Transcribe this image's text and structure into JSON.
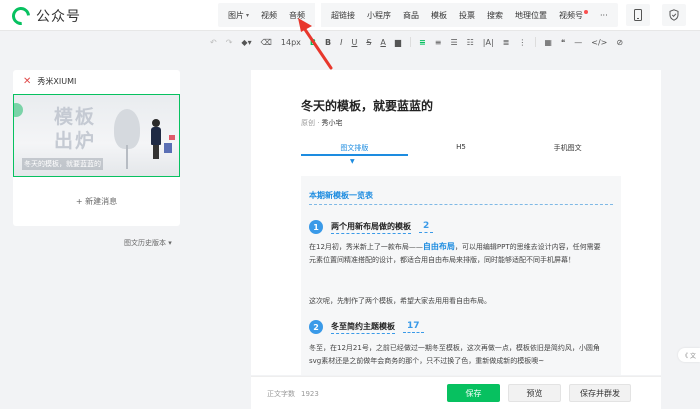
{
  "header": {
    "logo_text": "公众号",
    "insert_items": [
      {
        "label": "图片",
        "caret": "▾"
      },
      {
        "label": "视频"
      },
      {
        "label": "音频"
      }
    ],
    "insert_items_2": [
      {
        "label": "超链接"
      },
      {
        "label": "小程序"
      },
      {
        "label": "商品"
      },
      {
        "label": "模板"
      },
      {
        "label": "投票"
      },
      {
        "label": "搜索"
      },
      {
        "label": "地理位置"
      },
      {
        "label": "视频号"
      }
    ],
    "more_label": "···",
    "icons": [
      "mobile-icon",
      "shield-icon"
    ]
  },
  "format_toolbar": {
    "undo": "↶",
    "redo": "↷",
    "eraser": "⌫",
    "brush": "▾",
    "font_size": "14px",
    "bold_green": "B",
    "bold": "B",
    "italic": "I",
    "underline": "U",
    "strike": "S",
    "font_color": "A",
    "bg_color": "▆",
    "align": "≡",
    "indent": "≡",
    "list": "☰",
    "olist": "☷",
    "spacing": "|A|",
    "lh": "≣",
    "more1": "⋮",
    "table": "▦",
    "quote": "❝",
    "divider": "—",
    "code": "</>",
    "link": "⊘"
  },
  "left_panel": {
    "account_icon": "✕",
    "account_name": "秀米XIUMI",
    "thumb_big": "模板\n出炉",
    "thumb_caption": "冬天的模板，就要蓝蓝的",
    "new_message_label": "+ 新建消息",
    "history_label": "图文历史版本 ▾"
  },
  "editor": {
    "title": "冬天的模板，就要蓝蓝的",
    "author_prefix": "原创 ·",
    "author": "秀小宅",
    "tabs": [
      "图文排版",
      "H5",
      "手机图文"
    ],
    "active_tab_arrow": "▼",
    "section_head": "本期新模板一览表",
    "item1": {
      "num": "1",
      "title": "两个用新布局做的模板",
      "count": "2"
    },
    "para1_a": "在12月初，秀米新上了一款布局——",
    "para1_hl": "自由布局",
    "para1_b": "，可以用编辑PPT的思维去设计内容，任何需要元素位置间精准搭配的设计，都适合用自由布局来排版，同时能够适配不同手机屏幕！",
    "para2": "这次呢，先制作了两个模板，希望大家去用用看自由布局。",
    "item2": {
      "num": "2",
      "title": "冬至简约主题模板",
      "count": "17"
    },
    "para3": "冬至，在12月21号，之前已经做过一期冬至模板，这次再做一点，模板依旧是简约风，小圆角svg素材还是之前做年会商务的那个，只不过换了色，重新做成新的模板噢~"
  },
  "side_tab": "《 文",
  "bottom": {
    "word_count_label": "正文字数",
    "word_count": "1923",
    "save": "保存",
    "preview": "预览",
    "save_mass": "保存并群发"
  },
  "colors": {
    "accent": "#07c160",
    "link": "#1d8ce0",
    "annotation": "#e8372c"
  }
}
